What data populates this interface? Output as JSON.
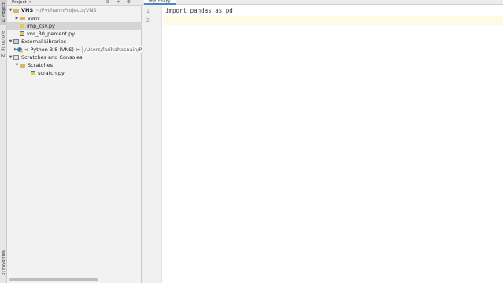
{
  "left_strip": {
    "project_tab": "1: Project",
    "structure_tab": "Z: Structure",
    "favorites_tab": "2: Favorites"
  },
  "project_panel": {
    "title": "Project",
    "tree": {
      "root": {
        "name": "VNS",
        "path": "~/PycharmProjects/VNS"
      },
      "venv": "venv",
      "file1": "imp_csv.py",
      "file2": "vns_30_percent.py",
      "external_libraries": "External Libraries",
      "python_env": {
        "name": "< Python 3.8 (VNS) >",
        "path": "/Users/farihahasnain/PycharmProjects/VNS/venv/bin/python"
      },
      "scratches_and_consoles": "Scratches and Consoles",
      "scratches": "Scratches",
      "scratch_file": "scratch.py"
    }
  },
  "editor": {
    "tab_label": "imp_csv.py",
    "line_numbers": [
      "1",
      "2"
    ],
    "lines": [
      "import pandas as pd",
      ""
    ]
  },
  "colors": {
    "panel_bg": "#f2f2f2",
    "selection": "#d5d5d5",
    "current_line": "#fdfbe6",
    "tab_underline": "#4a88c7"
  }
}
